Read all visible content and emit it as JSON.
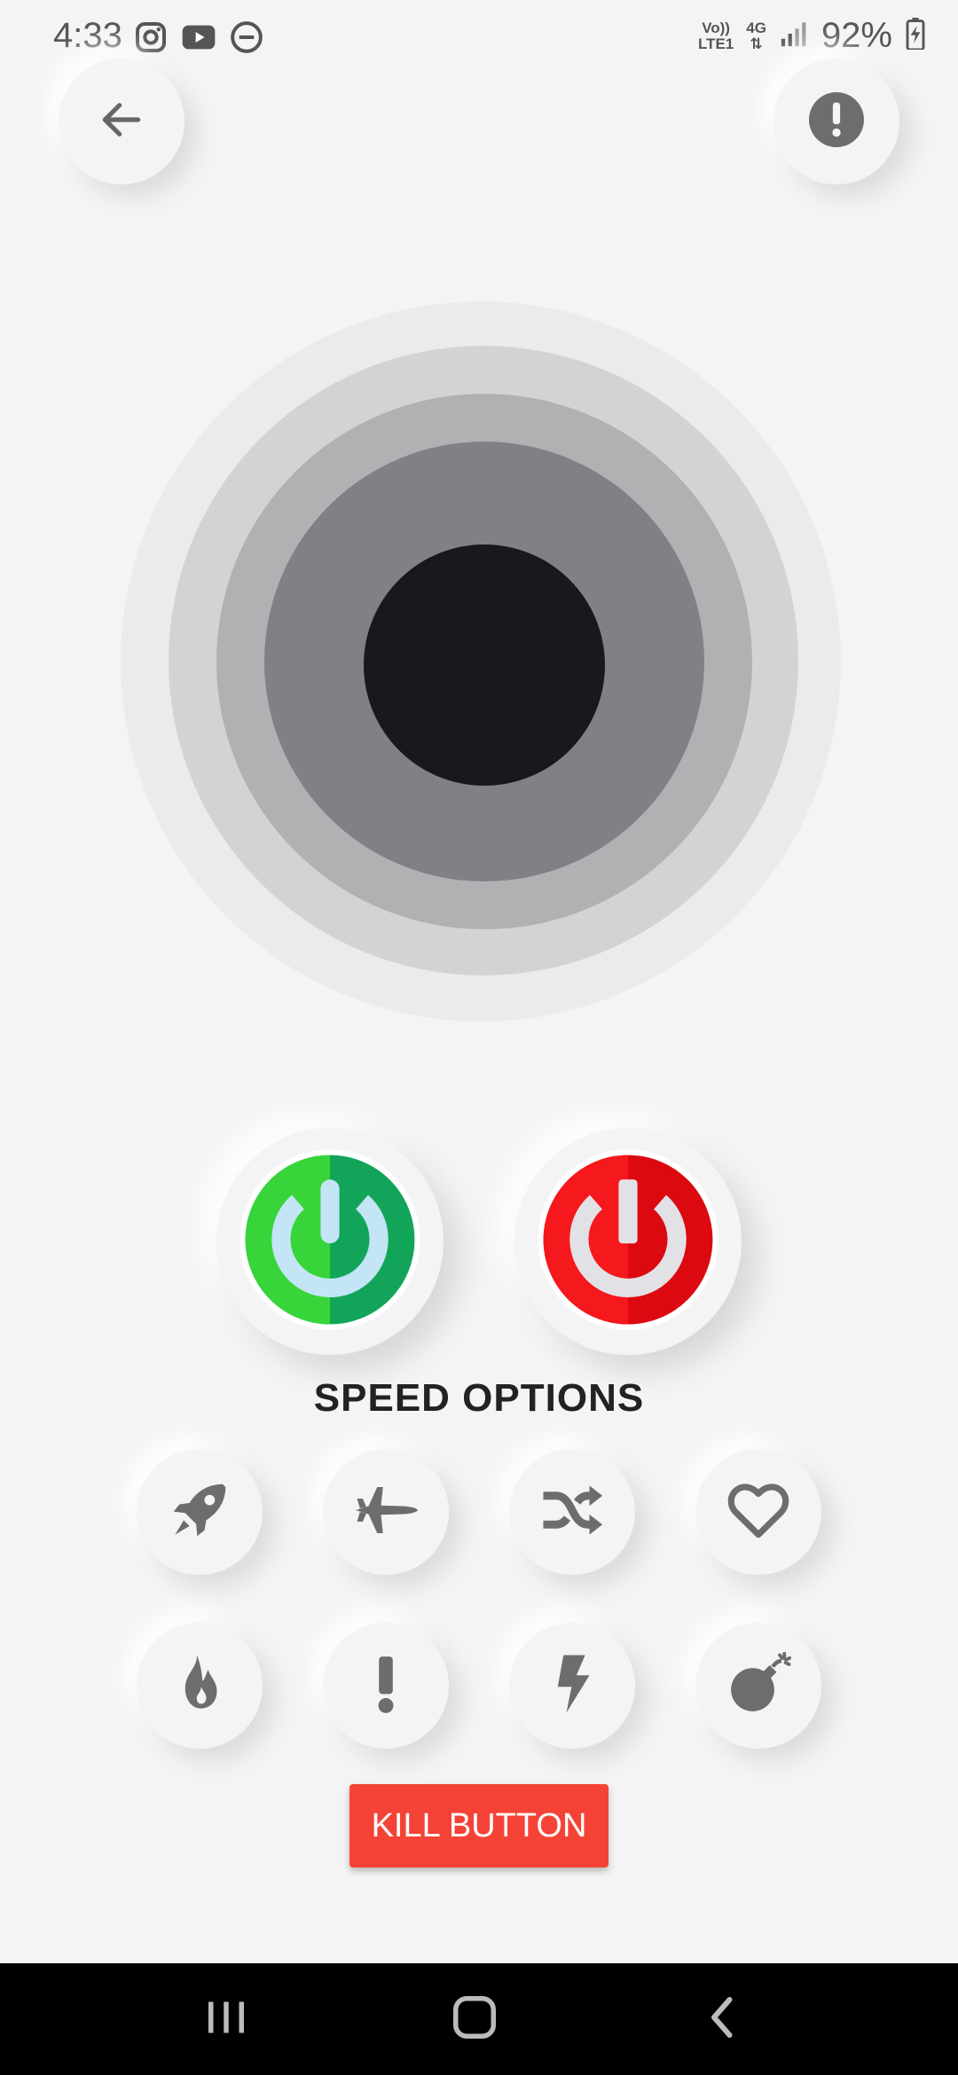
{
  "status_bar": {
    "time": "4:33",
    "network_top": "Vo))",
    "network_bottom": "LTE1",
    "data_type": "4G",
    "battery": "92%",
    "left_icons": [
      "instagram-icon",
      "youtube-icon",
      "do-not-disturb-icon"
    ]
  },
  "header": {
    "back_icon": "arrow-left-icon",
    "info_icon": "exclamation-circle-icon"
  },
  "colors": {
    "background": "#f4f4f4",
    "power_on_green": "#37d53a",
    "power_on_green_dark": "#12a55a",
    "power_off_red": "#f5191e",
    "kill_button": "#f44336",
    "core_black": "#18191d"
  },
  "speed_section": {
    "title": "SPEED OPTIONS",
    "options": [
      {
        "icon": "rocket-icon"
      },
      {
        "icon": "airplane-icon"
      },
      {
        "icon": "shuffle-icon"
      },
      {
        "icon": "heart-icon"
      },
      {
        "icon": "fire-icon"
      },
      {
        "icon": "exclamation-icon"
      },
      {
        "icon": "bolt-icon"
      },
      {
        "icon": "bomb-icon"
      }
    ]
  },
  "kill_button": {
    "label": "KILL BUTTON"
  },
  "nav_bar": {
    "items": [
      "recents-icon",
      "home-icon",
      "back-nav-icon"
    ]
  }
}
